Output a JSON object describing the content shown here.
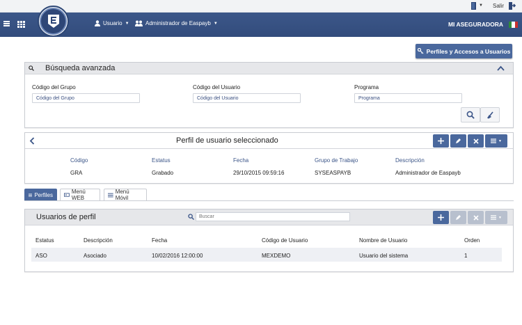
{
  "topbar": {
    "exit_label": "Salir"
  },
  "header": {
    "nav_usuario": "Usuario",
    "nav_admin": "Administrador de Easpayb",
    "brand": "MI ASEGURADORA",
    "colors": {
      "header": "#3a5486",
      "accent": "#4a689d"
    }
  },
  "actions": {
    "perfiles_button": "Perfiles y Accesos a Usuarios"
  },
  "busqueda": {
    "title": "Búsqueda avanzada",
    "fields": [
      {
        "label": "Código del Grupo",
        "placeholder": "Código del Grupo"
      },
      {
        "label": "Código del Usuario",
        "placeholder": "Código del Usuario"
      },
      {
        "label": "Programa",
        "placeholder": "Programa"
      }
    ]
  },
  "perfil": {
    "title": "Perfil de usuario seleccionado",
    "columns": [
      "Código",
      "Estatus",
      "Fecha",
      "Grupo de Trabajo",
      "Descripción"
    ],
    "values": [
      "GRA",
      "Grabado",
      "29/10/2015 09:59:16",
      "SYSEASPAYB",
      "Administrador de Easpayb"
    ]
  },
  "tabs": [
    {
      "label": "Perfiles",
      "active": true
    },
    {
      "label": "Menú WEB",
      "active": false
    },
    {
      "label": "Menú Móvil",
      "active": false
    }
  ],
  "usuarios": {
    "title": "Usuarios de perfil",
    "search_placeholder": "Buscar",
    "columns": [
      "Estatus",
      "Descripción",
      "Fecha",
      "Código de Usuario",
      "Nombre de Usuario",
      "Orden"
    ],
    "rows": [
      [
        "ASO",
        "Asociado",
        "10/02/2016 12:00:00",
        "MEXDEMO",
        "Usuario del sistema",
        "1"
      ]
    ]
  }
}
